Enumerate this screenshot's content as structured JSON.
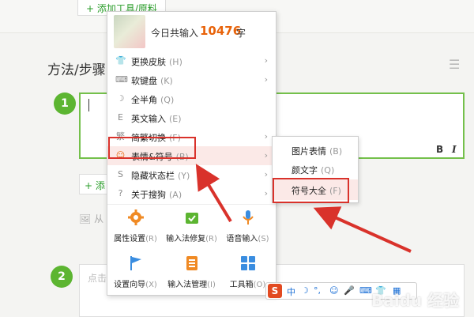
{
  "page": {
    "add_tool_top": "+ 添加工具/原料",
    "steps_title": "方法/步骤",
    "step1_number": "1",
    "step2_number": "2",
    "bold_label": "B",
    "italic_label": "I",
    "add_tool_mid": "+ 添加",
    "from_label": "从",
    "editor2_placeholder": "点击"
  },
  "ime_menu": {
    "today_label": "今日共输入",
    "today_count": "10476",
    "today_unit": "字",
    "items": [
      {
        "label": "更换皮肤",
        "key": "(H)",
        "icon": "shirt-icon",
        "has_submenu": true
      },
      {
        "label": "软键盘",
        "key": "(K)",
        "icon": "keyboard-icon",
        "has_submenu": true
      },
      {
        "label": "全半角",
        "key": "(Q)",
        "icon": "moon-icon",
        "has_submenu": false
      },
      {
        "label": "英文输入",
        "key": "(E)",
        "icon": "english-icon",
        "has_submenu": false
      },
      {
        "label": "简繁切换",
        "key": "(F)",
        "icon": "traditional-icon",
        "has_submenu": true
      },
      {
        "label": "表情&符号",
        "key": "(B)",
        "icon": "smiley-icon",
        "has_submenu": true
      },
      {
        "label": "隐藏状态栏",
        "key": "(Y)",
        "icon": "hide-statusbar-icon",
        "has_submenu": true
      },
      {
        "label": "关于搜狗",
        "key": "(A)",
        "icon": "question-icon",
        "has_submenu": true
      }
    ],
    "grid": [
      {
        "label": "属性设置",
        "key": "(R)",
        "icon": "gear-icon",
        "color": "#f08a24"
      },
      {
        "label": "输入法修复",
        "key": "(R)",
        "icon": "repair-icon",
        "color": "#5cb531"
      },
      {
        "label": "语音输入",
        "key": "(S)",
        "icon": "microphone-icon",
        "color": "#3a8de0"
      },
      {
        "label": "设置向导",
        "key": "(X)",
        "icon": "flag-icon",
        "color": "#3a8de0"
      },
      {
        "label": "输入法管理",
        "key": "(I)",
        "icon": "manage-icon",
        "color": "#f08a24"
      },
      {
        "label": "工具箱",
        "key": "(O)",
        "icon": "toolbox-icon",
        "color": "#3a8de0"
      }
    ]
  },
  "submenu": {
    "items": [
      {
        "label": "图片表情",
        "key": "(B)"
      },
      {
        "label": "颜文字",
        "key": "(Q)"
      },
      {
        "label": "符号大全",
        "key": "(F)"
      }
    ]
  },
  "status_bar": {
    "logo": "S",
    "mode": "中",
    "half_full": "☽",
    "punct": "°,",
    "emoji": "☺",
    "voice": "🎤",
    "keyboard": "⌨",
    "user": "👕"
  },
  "watermark": "Baidu 经验",
  "colors": {
    "accent_green": "#5cb531",
    "highlight_red": "#d9322b",
    "count_orange": "#e8630a",
    "hover_bg": "#fbe9e7"
  }
}
